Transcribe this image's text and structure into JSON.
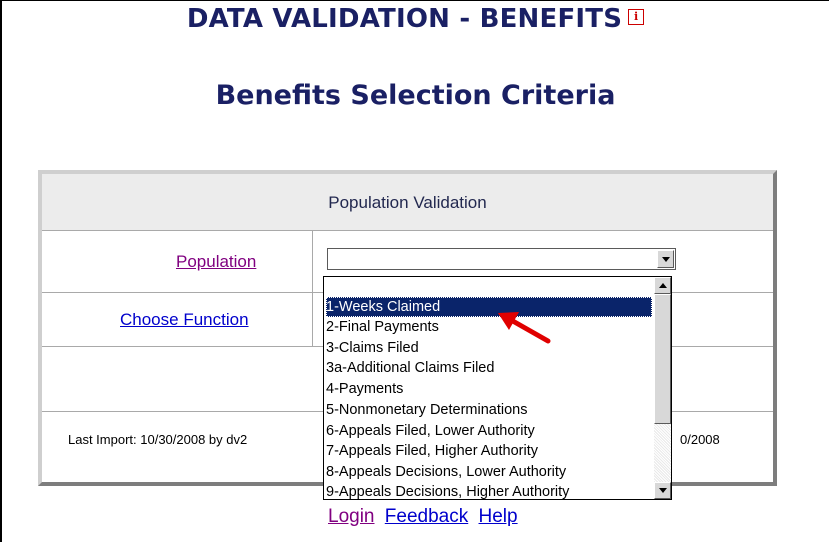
{
  "header": {
    "title": "DATA VALIDATION - BENEFITS",
    "info_icon": "i",
    "subtitle": "Benefits Selection Criteria"
  },
  "panel": {
    "header": "Population Validation",
    "population_label": "Population",
    "choose_function_label": "Choose Function",
    "population_select_value": "",
    "footer_left": "Last Import: 10/30/2008 by dv2",
    "footer_right_partial": "0/2008"
  },
  "dropdown": {
    "selected_index": 0,
    "options": [
      "1-Weeks Claimed",
      "2-Final Payments",
      "3-Claims Filed",
      "3a-Additional Claims Filed",
      "4-Payments",
      "5-Nonmonetary Determinations",
      "6-Appeals Filed, Lower Authority",
      "7-Appeals Filed, Higher Authority",
      "8-Appeals Decisions, Lower Authority",
      "9-Appeals Decisions, Higher Authority"
    ]
  },
  "links": {
    "login": "Login",
    "feedback": "Feedback",
    "help": "Help"
  },
  "colors": {
    "title": "#1a2064",
    "visited_link": "#800080",
    "link": "#0000cc",
    "selection": "#0a246a",
    "arrow": "#e00000"
  }
}
